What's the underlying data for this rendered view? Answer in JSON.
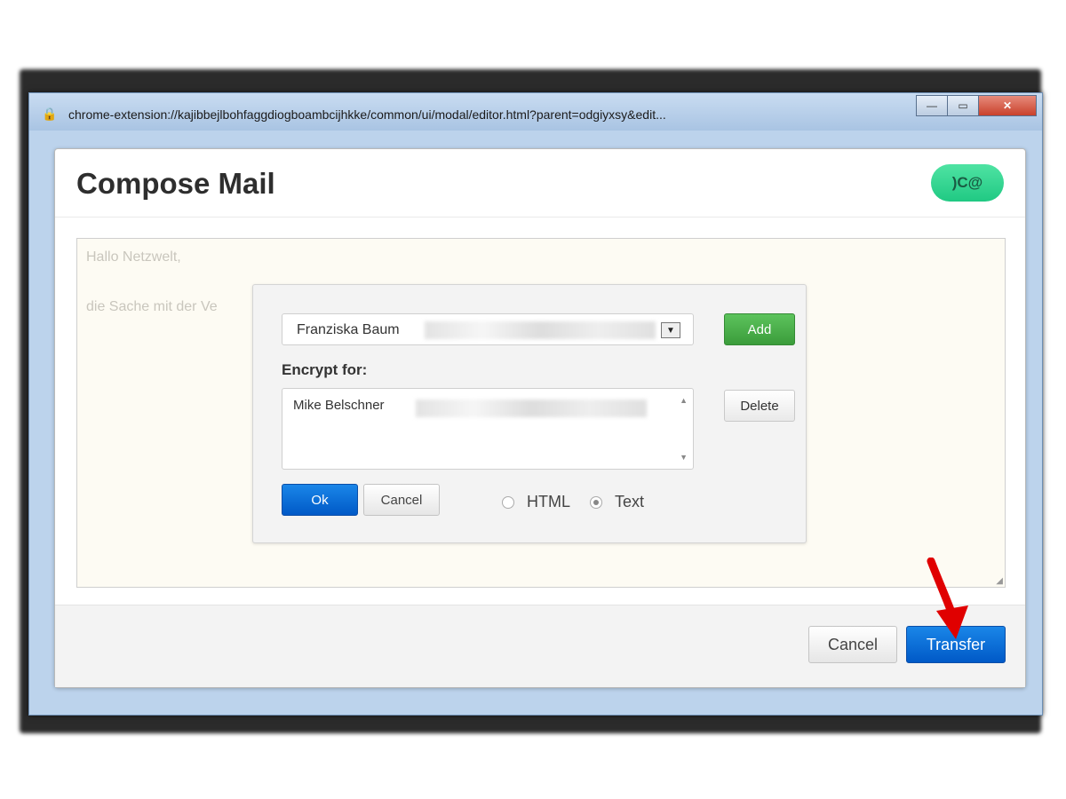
{
  "window": {
    "url": "chrome-extension://kajibbejlbohfaggdiogboambcijhkke/common/ui/modal/editor.html?parent=odgiyxsy&edit...",
    "minimize_label": "—",
    "maximize_label": "▭",
    "close_label": "✕"
  },
  "compose": {
    "title": "Compose Mail",
    "brand_badge": ")C@"
  },
  "editor": {
    "line1": "Hallo Netzwelt,",
    "line2": "die Sache mit der Ve"
  },
  "dialog": {
    "selected_recipient": "Franziska Baum",
    "add_label": "Add",
    "encrypt_for_label": "Encrypt for:",
    "recipients": [
      "Mike Belschner"
    ],
    "delete_label": "Delete",
    "ok_label": "Ok",
    "cancel_label": "Cancel",
    "format_options": [
      "HTML",
      "Text"
    ],
    "selected_format": "Text"
  },
  "footer": {
    "cancel_label": "Cancel",
    "transfer_label": "Transfer"
  },
  "colors": {
    "primary_button": "#0a6fd9",
    "add_button": "#4caf50",
    "brand_badge": "#2dd48f",
    "annotation_arrow": "#e00000"
  }
}
